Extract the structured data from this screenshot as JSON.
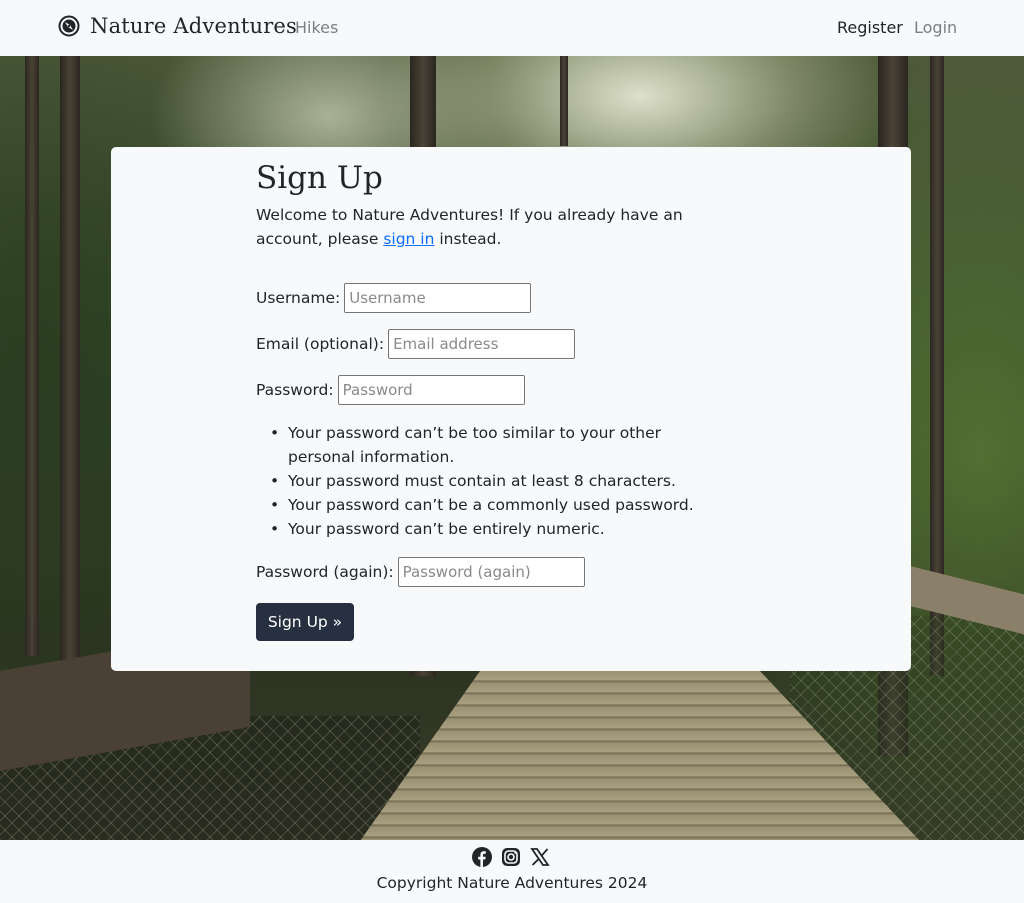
{
  "navbar": {
    "brand": "Nature Adventures",
    "brand_icon": "compass-icon",
    "links": {
      "hikes": "Hikes",
      "register": "Register",
      "login": "Login"
    }
  },
  "signup": {
    "title": "Sign Up",
    "intro_before": "Welcome to Nature Adventures! If you already have an account, please ",
    "intro_link": "sign in",
    "intro_after": " instead.",
    "fields": {
      "username": {
        "label": "Username:",
        "placeholder": "Username",
        "value": ""
      },
      "email": {
        "label": "Email (optional):",
        "placeholder": "Email address",
        "value": ""
      },
      "password": {
        "label": "Password:",
        "placeholder": "Password",
        "value": ""
      },
      "password2": {
        "label": "Password (again):",
        "placeholder": "Password (again)",
        "value": ""
      }
    },
    "password_help": [
      "Your password can’t be too similar to your other personal information.",
      "Your password must contain at least 8 characters.",
      "Your password can’t be a commonly used password.",
      "Your password can’t be entirely numeric."
    ],
    "submit_label": "Sign Up »"
  },
  "footer": {
    "social_icons": [
      "facebook-icon",
      "instagram-icon",
      "x-twitter-icon"
    ],
    "copyright": "Copyright Nature Adventures 2024"
  },
  "colors": {
    "navbar_bg": "#f8f9fa",
    "button_bg": "#263040",
    "link": "#0d6efd"
  }
}
